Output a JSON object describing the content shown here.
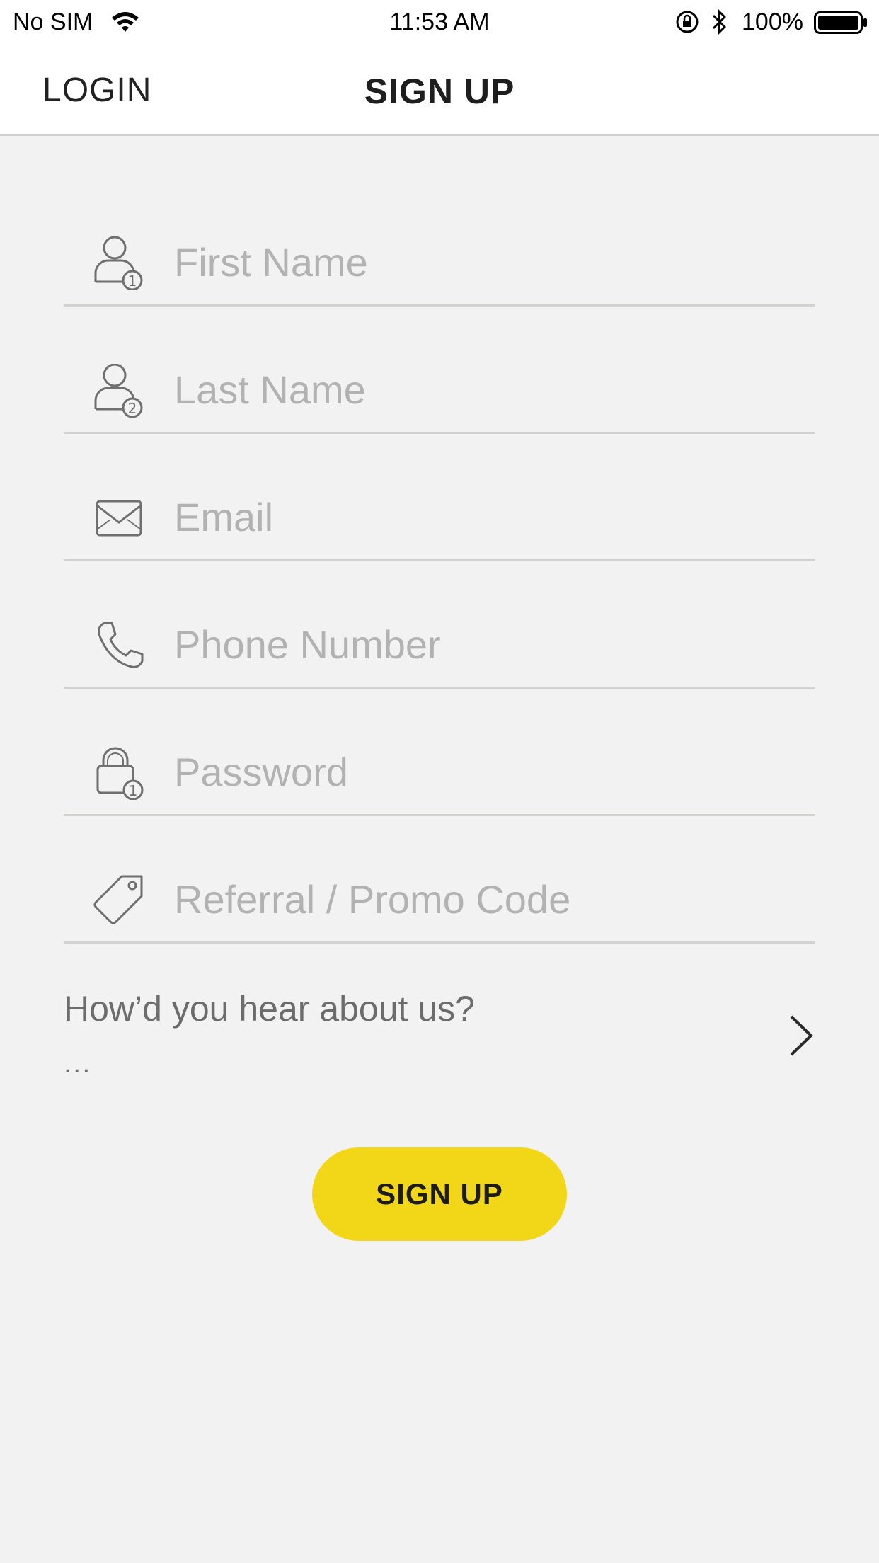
{
  "status_bar": {
    "carrier": "No SIM",
    "time": "11:53 AM",
    "battery": "100%"
  },
  "nav": {
    "login_tab": "LOGIN",
    "title": "SIGN UP"
  },
  "form": {
    "first_name": {
      "placeholder": "First Name",
      "icon": "person-1-icon"
    },
    "last_name": {
      "placeholder": "Last Name",
      "icon": "person-2-icon"
    },
    "email": {
      "placeholder": "Email",
      "icon": "envelope-icon"
    },
    "phone": {
      "placeholder": "Phone Number",
      "icon": "phone-icon"
    },
    "password": {
      "placeholder": "Password",
      "icon": "lock-icon"
    },
    "promo": {
      "placeholder": "Referral / Promo Code",
      "icon": "tag-icon"
    },
    "hear_about": {
      "question": "How’d you hear about us?",
      "value": "..."
    },
    "submit_label": "SIGN UP"
  },
  "colors": {
    "accent": "#f2d718",
    "background": "#f2f2f2",
    "icon": "#6f6f6f",
    "placeholder": "#b2b2b2"
  }
}
